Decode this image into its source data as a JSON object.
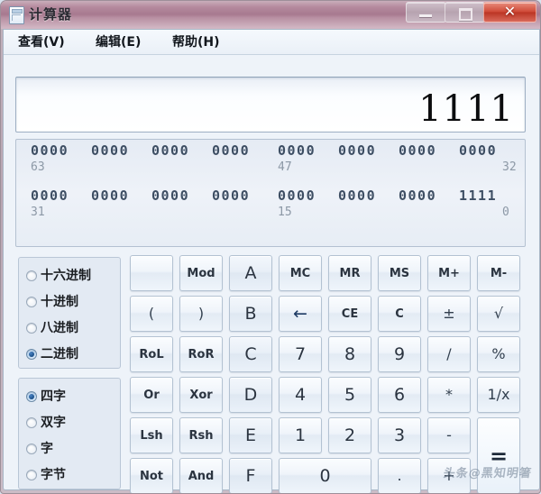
{
  "window": {
    "title": "计算器",
    "icon": "calculator-icon",
    "controls": {
      "minimize": "—",
      "maximize": "❐",
      "close": "✕"
    }
  },
  "menu": {
    "items": [
      {
        "label": "查看(V)"
      },
      {
        "label": "编辑(E)"
      },
      {
        "label": "帮助(H)"
      }
    ]
  },
  "display": {
    "value": "1111"
  },
  "bit_display": {
    "rows": [
      {
        "nibbles": [
          "0000",
          "0000",
          "0000",
          "0000",
          "0000",
          "0000",
          "0000",
          "0000"
        ],
        "labels": [
          {
            "text": "63",
            "align": "left",
            "after_group": 0
          },
          {
            "text": "47",
            "align": "left",
            "after_group": 4
          },
          {
            "text": "32",
            "align": "right",
            "after_group": 7
          }
        ]
      },
      {
        "nibbles": [
          "0000",
          "0000",
          "0000",
          "0000",
          "0000",
          "0000",
          "0000",
          "1111"
        ],
        "labels": [
          {
            "text": "31",
            "align": "left",
            "after_group": 0
          },
          {
            "text": "15",
            "align": "left",
            "after_group": 4
          },
          {
            "text": "0",
            "align": "right",
            "after_group": 7
          }
        ]
      }
    ]
  },
  "base_group": {
    "options": [
      {
        "label": "十六进制",
        "checked": false
      },
      {
        "label": "十进制",
        "checked": false
      },
      {
        "label": "八进制",
        "checked": false
      },
      {
        "label": "二进制",
        "checked": true
      }
    ]
  },
  "word_group": {
    "options": [
      {
        "label": "四字",
        "checked": true
      },
      {
        "label": "双字",
        "checked": false
      },
      {
        "label": "字",
        "checked": false
      },
      {
        "label": "字节",
        "checked": false
      }
    ]
  },
  "keypad": {
    "buttons": [
      {
        "label": "",
        "name": "blank-button",
        "kind": "blank",
        "col": 0,
        "row": 0
      },
      {
        "label": "Mod",
        "name": "mod-button",
        "kind": "fn",
        "col": 1,
        "row": 0
      },
      {
        "label": "A",
        "name": "hex-a-button",
        "kind": "hexletter",
        "col": 2,
        "row": 0
      },
      {
        "label": "MC",
        "name": "memory-clear-button",
        "kind": "fn",
        "col": 3,
        "row": 0
      },
      {
        "label": "MR",
        "name": "memory-recall-button",
        "kind": "fn",
        "col": 4,
        "row": 0
      },
      {
        "label": "MS",
        "name": "memory-store-button",
        "kind": "fn",
        "col": 5,
        "row": 0
      },
      {
        "label": "M+",
        "name": "memory-add-button",
        "kind": "fn",
        "col": 6,
        "row": 0
      },
      {
        "label": "M-",
        "name": "memory-subtract-button",
        "kind": "fn",
        "col": 7,
        "row": 0
      },
      {
        "label": "(",
        "name": "left-paren-button",
        "kind": "op",
        "col": 0,
        "row": 1
      },
      {
        "label": ")",
        "name": "right-paren-button",
        "kind": "op",
        "col": 1,
        "row": 1
      },
      {
        "label": "B",
        "name": "hex-b-button",
        "kind": "hexletter",
        "col": 2,
        "row": 1
      },
      {
        "label": "←",
        "name": "backspace-button",
        "kind": "arrow",
        "col": 3,
        "row": 1
      },
      {
        "label": "CE",
        "name": "clear-entry-button",
        "kind": "fn",
        "col": 4,
        "row": 1
      },
      {
        "label": "C",
        "name": "clear-button",
        "kind": "fn",
        "col": 5,
        "row": 1
      },
      {
        "label": "±",
        "name": "sign-toggle-button",
        "kind": "op",
        "col": 6,
        "row": 1
      },
      {
        "label": "√",
        "name": "square-root-button",
        "kind": "op",
        "col": 7,
        "row": 1
      },
      {
        "label": "RoL",
        "name": "rotate-left-button",
        "kind": "fn",
        "col": 0,
        "row": 2
      },
      {
        "label": "RoR",
        "name": "rotate-right-button",
        "kind": "fn",
        "col": 1,
        "row": 2
      },
      {
        "label": "C",
        "name": "hex-c-button",
        "kind": "hexletter",
        "col": 2,
        "row": 2
      },
      {
        "label": "7",
        "name": "digit-7-button",
        "kind": "digit",
        "col": 3,
        "row": 2
      },
      {
        "label": "8",
        "name": "digit-8-button",
        "kind": "digit",
        "col": 4,
        "row": 2
      },
      {
        "label": "9",
        "name": "digit-9-button",
        "kind": "digit",
        "col": 5,
        "row": 2
      },
      {
        "label": "/",
        "name": "divide-button",
        "kind": "op",
        "col": 6,
        "row": 2
      },
      {
        "label": "%",
        "name": "percent-button",
        "kind": "op",
        "col": 7,
        "row": 2
      },
      {
        "label": "Or",
        "name": "bitwise-or-button",
        "kind": "fn",
        "col": 0,
        "row": 3
      },
      {
        "label": "Xor",
        "name": "bitwise-xor-button",
        "kind": "fn",
        "col": 1,
        "row": 3
      },
      {
        "label": "D",
        "name": "hex-d-button",
        "kind": "hexletter",
        "col": 2,
        "row": 3
      },
      {
        "label": "4",
        "name": "digit-4-button",
        "kind": "digit",
        "col": 3,
        "row": 3
      },
      {
        "label": "5",
        "name": "digit-5-button",
        "kind": "digit",
        "col": 4,
        "row": 3
      },
      {
        "label": "6",
        "name": "digit-6-button",
        "kind": "digit",
        "col": 5,
        "row": 3
      },
      {
        "label": "*",
        "name": "multiply-button",
        "kind": "op",
        "col": 6,
        "row": 3
      },
      {
        "label": "1/x",
        "name": "reciprocal-button",
        "kind": "op",
        "col": 7,
        "row": 3
      },
      {
        "label": "Lsh",
        "name": "left-shift-button",
        "kind": "fn",
        "col": 0,
        "row": 4
      },
      {
        "label": "Rsh",
        "name": "right-shift-button",
        "kind": "fn",
        "col": 1,
        "row": 4
      },
      {
        "label": "E",
        "name": "hex-e-button",
        "kind": "hexletter",
        "col": 2,
        "row": 4
      },
      {
        "label": "1",
        "name": "digit-1-button",
        "kind": "digit",
        "col": 3,
        "row": 4
      },
      {
        "label": "2",
        "name": "digit-2-button",
        "kind": "digit",
        "col": 4,
        "row": 4
      },
      {
        "label": "3",
        "name": "digit-3-button",
        "kind": "digit",
        "col": 5,
        "row": 4
      },
      {
        "label": "-",
        "name": "subtract-button",
        "kind": "op",
        "col": 6,
        "row": 4
      },
      {
        "label": "Not",
        "name": "bitwise-not-button",
        "kind": "fn",
        "col": 0,
        "row": 5
      },
      {
        "label": "And",
        "name": "bitwise-and-button",
        "kind": "fn",
        "col": 1,
        "row": 5
      },
      {
        "label": "F",
        "name": "hex-f-button",
        "kind": "hexletter",
        "col": 2,
        "row": 5
      },
      {
        "label": "0",
        "name": "digit-0-button",
        "kind": "digit",
        "col": 3,
        "row": 5,
        "colspan": 2
      },
      {
        "label": ".",
        "name": "decimal-point-button",
        "kind": "op",
        "col": 5,
        "row": 5
      },
      {
        "label": "+",
        "name": "add-button",
        "kind": "op",
        "col": 6,
        "row": 5
      },
      {
        "label": "=",
        "name": "equals-button",
        "kind": "equals",
        "col": 7,
        "row": 4,
        "rowspan": 2
      }
    ]
  },
  "watermark": {
    "text": "头条@黑知明箸"
  },
  "colors": {
    "titlebar": "#a7798f",
    "close_button": "#cf4a37",
    "client_bg": "#eef3f9",
    "bit_text": "#3d4e63",
    "bit_label": "#8c98a6",
    "accent_radio": "#1b4f88"
  }
}
